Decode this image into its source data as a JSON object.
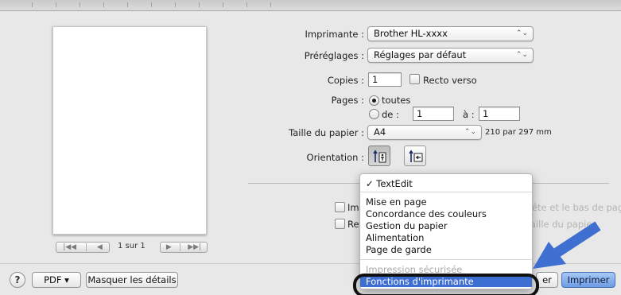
{
  "printer": {
    "label": "Imprimante :",
    "value": "Brother HL-xxxx"
  },
  "presets": {
    "label": "Préréglages :",
    "value": "Réglages par défaut"
  },
  "copies": {
    "label": "Copies :",
    "value": "1",
    "two_sided_label": "Recto verso"
  },
  "pages": {
    "label": "Pages :",
    "all_label": "toutes",
    "from_label": "de :",
    "from_value": "1",
    "to_label": "à :",
    "to_value": "1"
  },
  "paper_size": {
    "label": "Taille du papier :",
    "value": "A4",
    "dimensions": "210 par 297 mm"
  },
  "orientation": {
    "label": "Orientation :"
  },
  "pager": {
    "text": "1 sur 1"
  },
  "background_options": {
    "option1_prefix": "Imp",
    "option1_hidden": "rimer l'en-tête et le bas de page",
    "option2_prefix": "Ref",
    "option2_hidden": "ormater à la taille du papier"
  },
  "menu": {
    "checked_item": "✓ TextEdit",
    "items": [
      "Mise en page",
      "Concordance des couleurs",
      "Gestion du papier",
      "Alimentation",
      "Page de garde"
    ],
    "partial_item": "Impression sécurisée",
    "selected_item": "Fonctions d'imprimante"
  },
  "buttons": {
    "help": "?",
    "pdf": "PDF ▾",
    "hide_details": "Masquer les détails",
    "cancel_partial": "er",
    "print": "Imprimer"
  },
  "colors": {
    "menu_highlight": "#3d6fd3",
    "primary_button": "#6c9ae4",
    "callout_arrow": "#3f6fd0"
  }
}
